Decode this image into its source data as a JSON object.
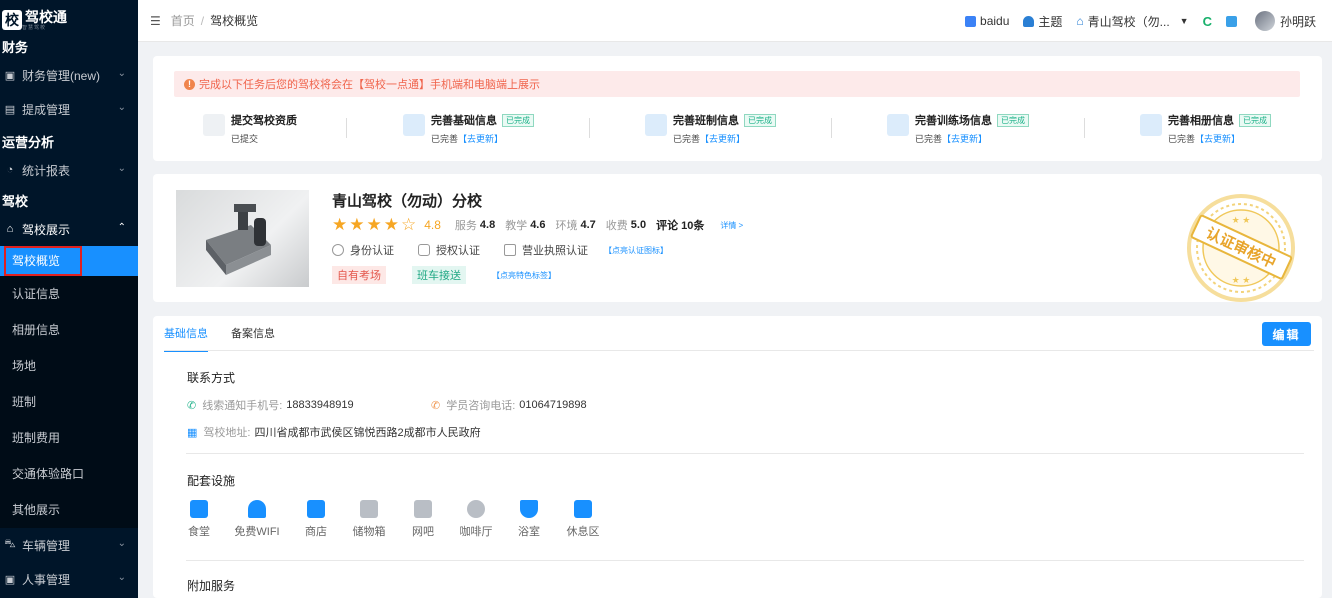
{
  "sidebar": {
    "logo_char": "校",
    "logo_text": "驾校通",
    "logo_sub": "智慧驾校",
    "groups": [
      {
        "title": "财务",
        "items": [
          {
            "label": "财务管理(new)"
          },
          {
            "label": "提成管理"
          }
        ]
      },
      {
        "title": "运营分析",
        "items": [
          {
            "label": "统计报表"
          }
        ]
      },
      {
        "title": "驾校",
        "items": [
          {
            "label": "驾校展示"
          }
        ]
      }
    ],
    "subitems": [
      "驾校概览",
      "认证信息",
      "相册信息",
      "场地",
      "班制",
      "班制费用",
      "交通体验路口",
      "其他展示"
    ],
    "bottom_items": [
      {
        "label": "车辆管理"
      },
      {
        "label": "人事管理"
      }
    ]
  },
  "topbar": {
    "breadcrumb_home": "首页",
    "breadcrumb_sep": "/",
    "breadcrumb_current": "驾校概览",
    "baidu": "baidu",
    "theme": "主题",
    "school_select": "青山驾校（勿...",
    "user": "孙明跃"
  },
  "tasks": {
    "notice": "完成以下任务后您的驾校将会在【驾校一点通】手机端和电脑端上展示",
    "items": [
      {
        "name": "提交驾校资质",
        "tag": "",
        "sub": "已提交",
        "link": ""
      },
      {
        "name": "完善基础信息",
        "tag": "已完成",
        "sub": "已完善",
        "link": "【去更新】"
      },
      {
        "name": "完善班制信息",
        "tag": "已完成",
        "sub": "已完善",
        "link": "【去更新】"
      },
      {
        "name": "完善训练场信息",
        "tag": "已完成",
        "sub": "已完善",
        "link": "【去更新】"
      },
      {
        "name": "完善相册信息",
        "tag": "已完成",
        "sub": "已完善",
        "link": "【去更新】"
      }
    ]
  },
  "school": {
    "name": "青山驾校（勿动）分校",
    "rating": {
      "stars": 4.5,
      "score": "4.8",
      "service_label": "服务",
      "service": "4.8",
      "teach_label": "教学",
      "teach": "4.6",
      "env_label": "环境",
      "env": "4.7",
      "fee_label": "收费",
      "fee": "5.0",
      "comments_label": "评论",
      "comments": "10条",
      "detail_link": "详情 >"
    },
    "certs": [
      "身份认证",
      "授权认证",
      "营业执照认证"
    ],
    "cert_link": "【点亮认证图标】",
    "features": [
      "自有考场",
      "班车接送"
    ],
    "feature_link": "【点亮特色标签】",
    "seal_text": "认证审核中"
  },
  "info": {
    "tabs": [
      "基础信息",
      "备案信息"
    ],
    "edit_label": "编辑",
    "contact_title": "联系方式",
    "phone_label": "线索通知手机号:",
    "phone": "18833948919",
    "consult_label": "学员咨询电话:",
    "consult": "01064719898",
    "address_label": "驾校地址:",
    "address": "四川省成都市武侯区锦悦西路2成都市人民政府",
    "facility_title": "配套设施",
    "facilities": [
      "食堂",
      "免费WIFI",
      "商店",
      "储物箱",
      "网吧",
      "咖啡厅",
      "浴室",
      "休息区"
    ],
    "extra_title": "附加服务"
  },
  "colors": {
    "primary": "#1890ff",
    "sidebar_bg": "#001529",
    "star": "#f6a623",
    "done_green": "#1fb28a",
    "seal_gold": "#e8b63c"
  }
}
